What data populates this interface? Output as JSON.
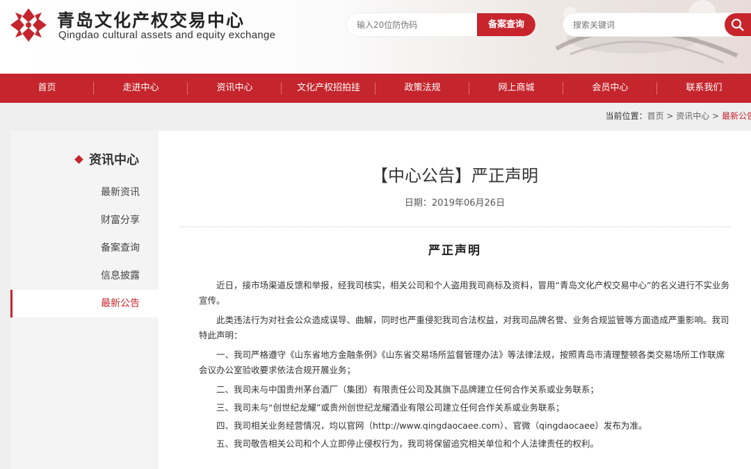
{
  "header": {
    "logo_cn": "青岛文化产权交易中心",
    "logo_en": "Qingdao cultural assets and equity exchange",
    "code_search": {
      "placeholder": "输入20位防伪码",
      "button": "备案查询"
    },
    "keyword_search": {
      "placeholder": "搜索关键词",
      "icon": "search-icon"
    }
  },
  "nav": [
    "首页",
    "走进中心",
    "资讯中心",
    "文化产权招拍挂",
    "政策法规",
    "网上商城",
    "会员中心",
    "联系我们"
  ],
  "breadcrumb": {
    "label": "当前位置：",
    "items": [
      "首页",
      "资讯中心",
      "最新公告"
    ],
    "separator": " > "
  },
  "sidebar": {
    "title": "资讯中心",
    "items": [
      "最新资讯",
      "财富分享",
      "备案查询",
      "信息披露",
      "最新公告"
    ],
    "active_index": 4
  },
  "article": {
    "title": "【中心公告】严正声明",
    "date": "日期：2019年06月26日",
    "subtitle": "严正声明",
    "paragraphs": [
      "近日，接市场渠道反馈和举报，经我司核实，相关公司和个人盗用我司商标及资料，冒用“青岛文化产权交易中心”的名义进行不实业务宣传。",
      "此类违法行为对社会公众造成误导、曲解，同时也严重侵犯我司合法权益，对我司品牌名誉、业务合规监管等方面造成严重影响。我司特此声明：",
      "一、我司严格遵守《山东省地方金融条例》《山东省交易场所监督管理办法》等法律法规，按照青岛市清理整顿各类交易场所工作联席会议办公室验收要求依法合规开展业务；",
      "二、我司未与中国贵州茅台酒厂（集团）有限责任公司及其旗下品牌建立任何合作关系或业务联系；",
      "三、我司未与“创世纪龙耀”或贵州创世纪龙耀酒业有限公司建立任何合作关系或业务联系；",
      "四、我司相关业务经营情况，均以官网（http://www.qingdaocaee.com）、官微（qingdaocaee）发布为准。",
      "五、我司敬告相关公司和个人立即停止侵权行为，我司将保留追究相关单位和个人法律责任的权利。"
    ]
  },
  "colors": {
    "accent": "#c5252c",
    "nav": "#c5252c",
    "sidebar_bg": "#f4f4f4"
  }
}
